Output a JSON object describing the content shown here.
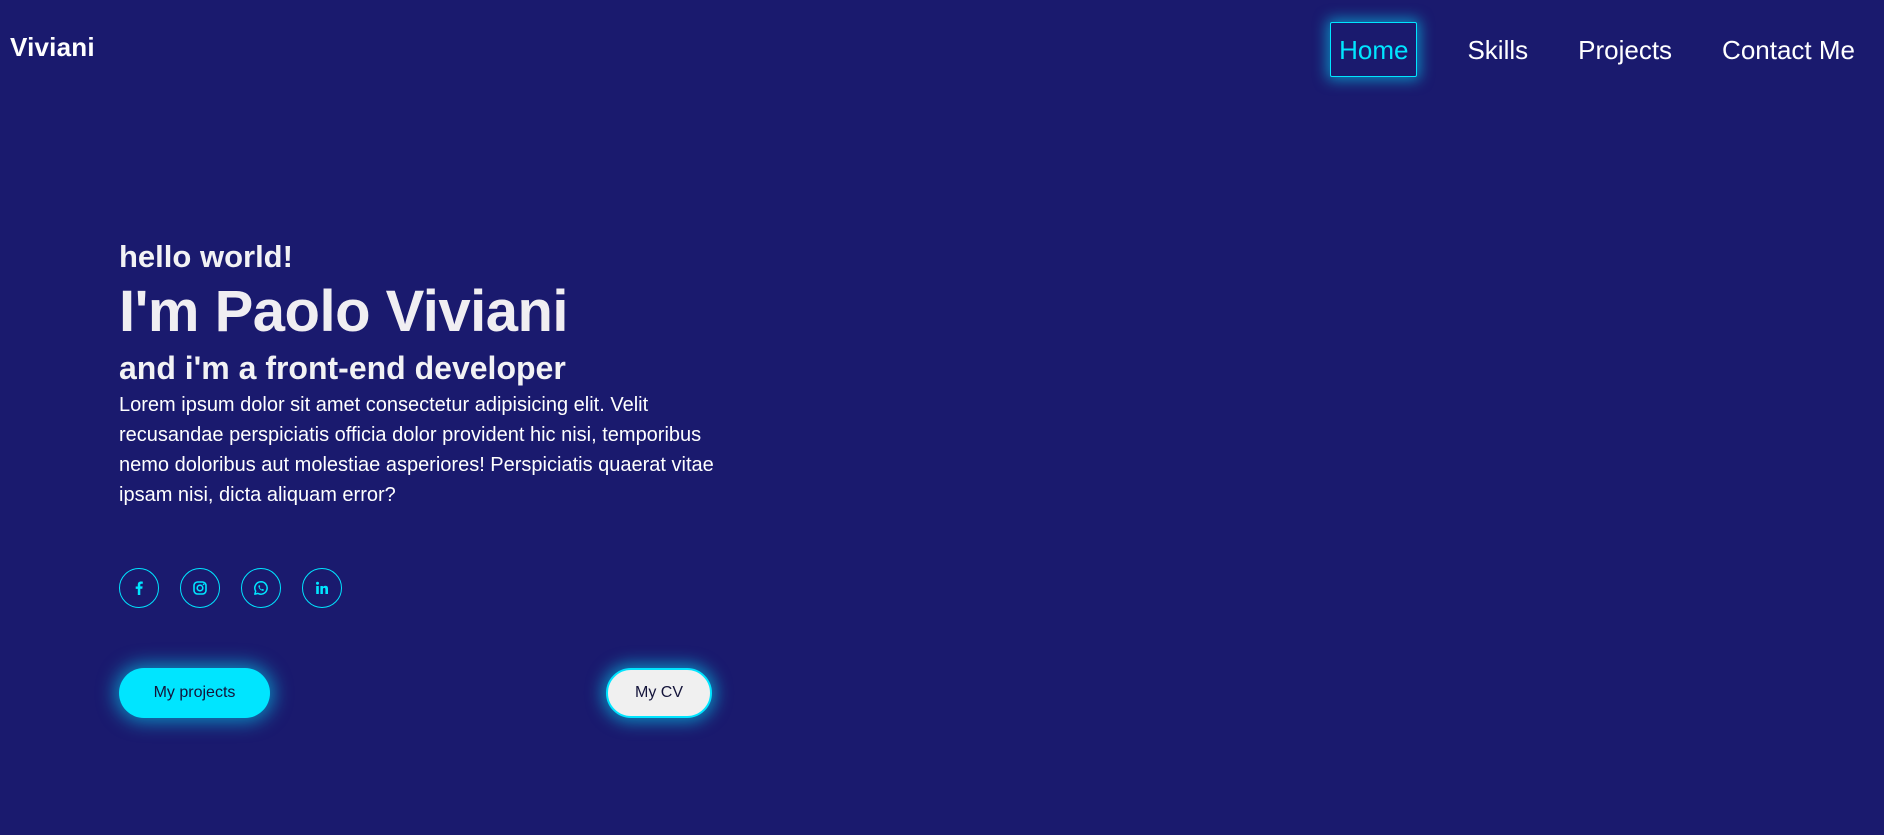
{
  "header": {
    "logo": "Viviani",
    "nav": [
      {
        "label": "Home",
        "active": true
      },
      {
        "label": "Skills",
        "active": false
      },
      {
        "label": "Projects",
        "active": false
      },
      {
        "label": "Contact Me",
        "active": false
      }
    ]
  },
  "hero": {
    "greeting": "hello world!",
    "name": "I'm Paolo Viviani",
    "role": "and i'm a front-end developer",
    "description": "Lorem ipsum dolor sit amet consectetur adipisicing elit. Velit recusandae perspiciatis officia dolor provident hic nisi, temporibus nemo doloribus aut molestiae asperiores! Perspiciatis quaerat vitae ipsam nisi, dicta aliquam error?"
  },
  "socials": [
    {
      "icon": "facebook-icon"
    },
    {
      "icon": "instagram-icon"
    },
    {
      "icon": "whatsapp-icon"
    },
    {
      "icon": "linkedin-icon"
    }
  ],
  "buttons": {
    "projects_label": "My projects",
    "cv_label": "My CV"
  },
  "colors": {
    "background": "#1a1a6e",
    "accent": "#00e5ff",
    "text": "#ffffff"
  }
}
